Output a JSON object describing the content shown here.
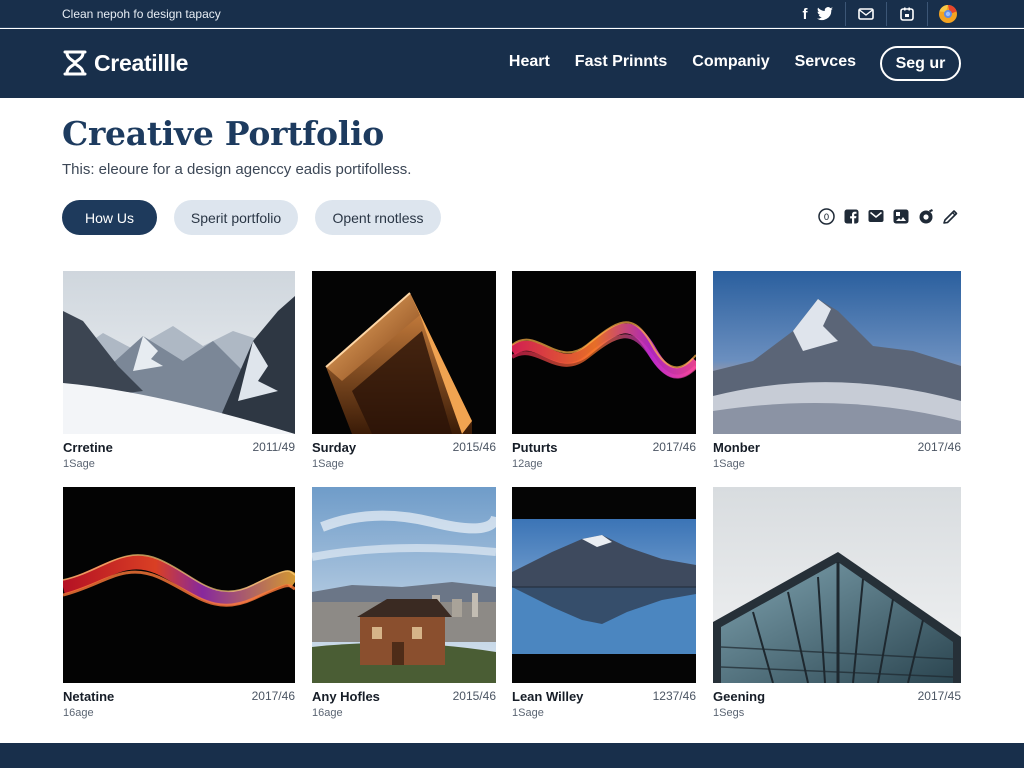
{
  "topbar": {
    "tagline": "Clean nepoh fo design tapacy",
    "icons": [
      "facebook-icon",
      "twitter-icon",
      "mail-icon",
      "calendar-icon",
      "browser-icon"
    ]
  },
  "header": {
    "logo_text": "Creatillle",
    "nav": [
      "Heart",
      "Fast Prinnts",
      "Companiy",
      "Servces"
    ],
    "signup_label": "Seg ur"
  },
  "hero": {
    "title": "Creative Portfolio",
    "subtitle": "This: eleoure for a design agenccy eadis portifolless.",
    "buttons": {
      "primary": "How Us",
      "secondary_1": "Sperit portfolio",
      "secondary_2": "Opent rnotless"
    },
    "toolbar_icons": [
      "info-icon",
      "facebook-icon",
      "mail-icon",
      "gallery-icon",
      "camera-icon",
      "pen-icon"
    ]
  },
  "cards": [
    {
      "title": "Crretine",
      "date": "2011/49",
      "sub": "1Sage",
      "image": "snowy-mountains"
    },
    {
      "title": "Surday",
      "date": "2015/46",
      "sub": "1Sage",
      "image": "orange-lit-tower"
    },
    {
      "title": "Puturts",
      "date": "2017/46",
      "sub": "12age",
      "image": "neon-wave"
    },
    {
      "title": "Monber",
      "date": "2017/46",
      "sub": "1Sage",
      "image": "dusk-mountain"
    },
    {
      "title": "Netatine",
      "date": "2017/46",
      "sub": "16age",
      "image": "red-ribbon-wave"
    },
    {
      "title": "Any Hofles",
      "date": "2015/46",
      "sub": "16age",
      "image": "wooden-house-city"
    },
    {
      "title": "Lean Willey",
      "date": "1237/46",
      "sub": "1Sage",
      "image": "lake-reflection"
    },
    {
      "title": "Geening",
      "date": "2017/45",
      "sub": "1Segs",
      "image": "glass-building"
    }
  ],
  "colors": {
    "navy": "#182f4b",
    "title_blue": "#1d3b5f",
    "pill_grey": "#dde5ee"
  }
}
